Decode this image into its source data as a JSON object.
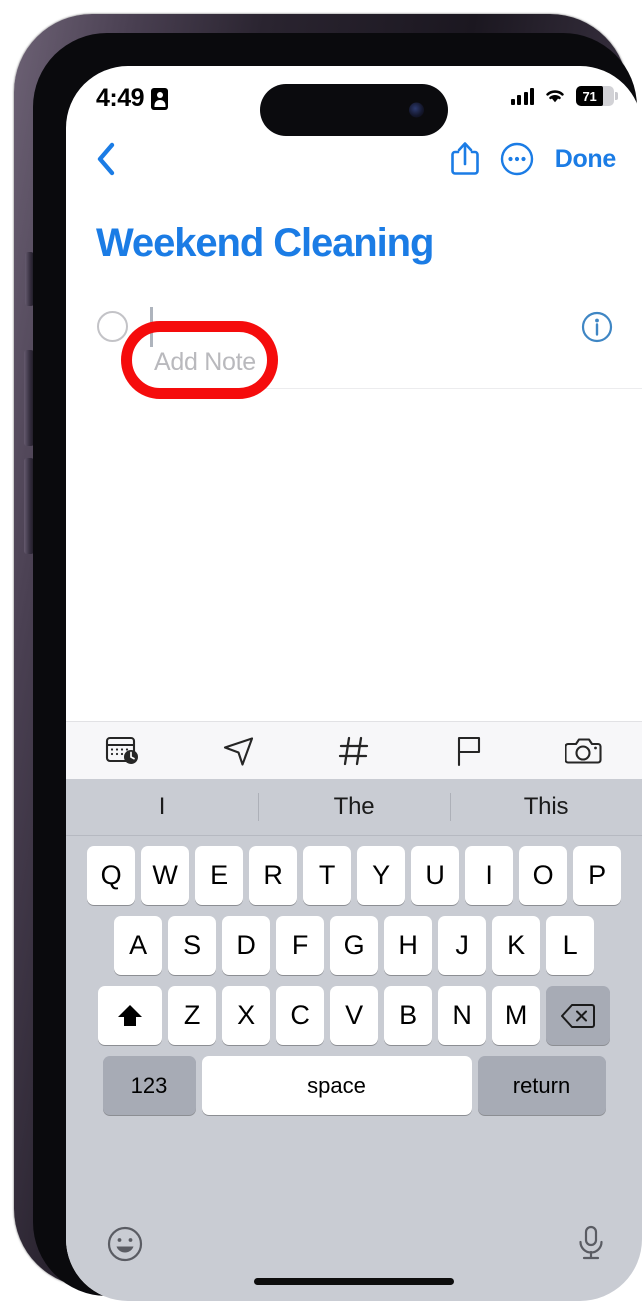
{
  "status_bar": {
    "time": "4:49",
    "focus_icon": "id-badge-icon",
    "signal_icon": "cellular-bars-icon",
    "wifi_icon": "wifi-icon",
    "battery_percent": "71",
    "battery_level": 71
  },
  "nav_bar": {
    "back_icon": "chevron-left-icon",
    "share_icon": "share-icon",
    "more_icon": "more-circle-icon",
    "done_label": "Done"
  },
  "note": {
    "title": "Weekend Cleaning",
    "checkbox_checked": false,
    "item_placeholder": "Add Note",
    "item_value": "",
    "info_icon": "info-circle-icon"
  },
  "annotation": {
    "shape": "oval",
    "color": "#f50c0c",
    "targets": "Add Note"
  },
  "accessory_toolbar": {
    "items": [
      {
        "name": "date-time-icon",
        "label": "Date and Time"
      },
      {
        "name": "location-icon",
        "label": "Location"
      },
      {
        "name": "tag-icon",
        "label": "Tag"
      },
      {
        "name": "flag-icon",
        "label": "Flag"
      },
      {
        "name": "camera-icon",
        "label": "Camera"
      }
    ]
  },
  "keyboard": {
    "predictions": [
      "I",
      "The",
      "This"
    ],
    "row1": [
      "Q",
      "W",
      "E",
      "R",
      "T",
      "Y",
      "U",
      "I",
      "O",
      "P"
    ],
    "row2": [
      "A",
      "S",
      "D",
      "F",
      "G",
      "H",
      "J",
      "K",
      "L"
    ],
    "row3": [
      "Z",
      "X",
      "C",
      "V",
      "B",
      "N",
      "M"
    ],
    "shift_icon": "shift-icon",
    "shift_active": true,
    "backspace_icon": "backspace-icon",
    "numbers_label": "123",
    "space_label": "space",
    "return_label": "return",
    "emoji_icon": "emoji-icon",
    "dictation_icon": "microphone-icon"
  },
  "colors": {
    "accent": "#1b7ce5",
    "annotation_red": "#f50c0c",
    "keyboard_bg": "#c9ccd3",
    "placeholder": "#b9b9bd"
  }
}
